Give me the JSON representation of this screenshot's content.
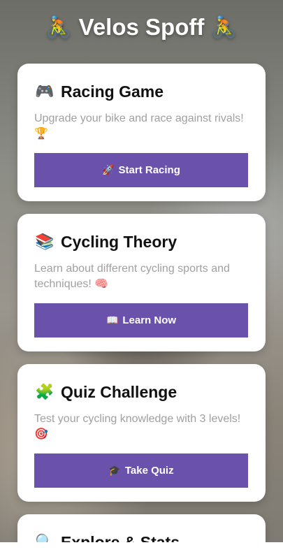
{
  "header": {
    "title": "Velos Spoff",
    "left_emoji": "🚴",
    "right_emoji": "🚴"
  },
  "cards": [
    {
      "emoji": "🎮",
      "title": "Racing Game",
      "description": "Upgrade your bike and race against rivals!",
      "desc_emoji": "🏆",
      "button_emoji": "🚀",
      "button_label": "Start Racing"
    },
    {
      "emoji": "📚",
      "title": "Cycling Theory",
      "description": "Learn about different cycling sports and techniques!",
      "desc_emoji": "🧠",
      "button_emoji": "📖",
      "button_label": "Learn Now"
    },
    {
      "emoji": "🧩",
      "title": "Quiz Challenge",
      "description": "Test your cycling knowledge with 3 levels!",
      "desc_emoji": "🎯",
      "button_emoji": "🎓",
      "button_label": "Take Quiz"
    },
    {
      "emoji": "🔍",
      "title": "Explore & Stats"
    }
  ],
  "colors": {
    "accent": "#6a52ac",
    "card_bg": "#ffffff",
    "desc_text": "#a0a0a0"
  }
}
